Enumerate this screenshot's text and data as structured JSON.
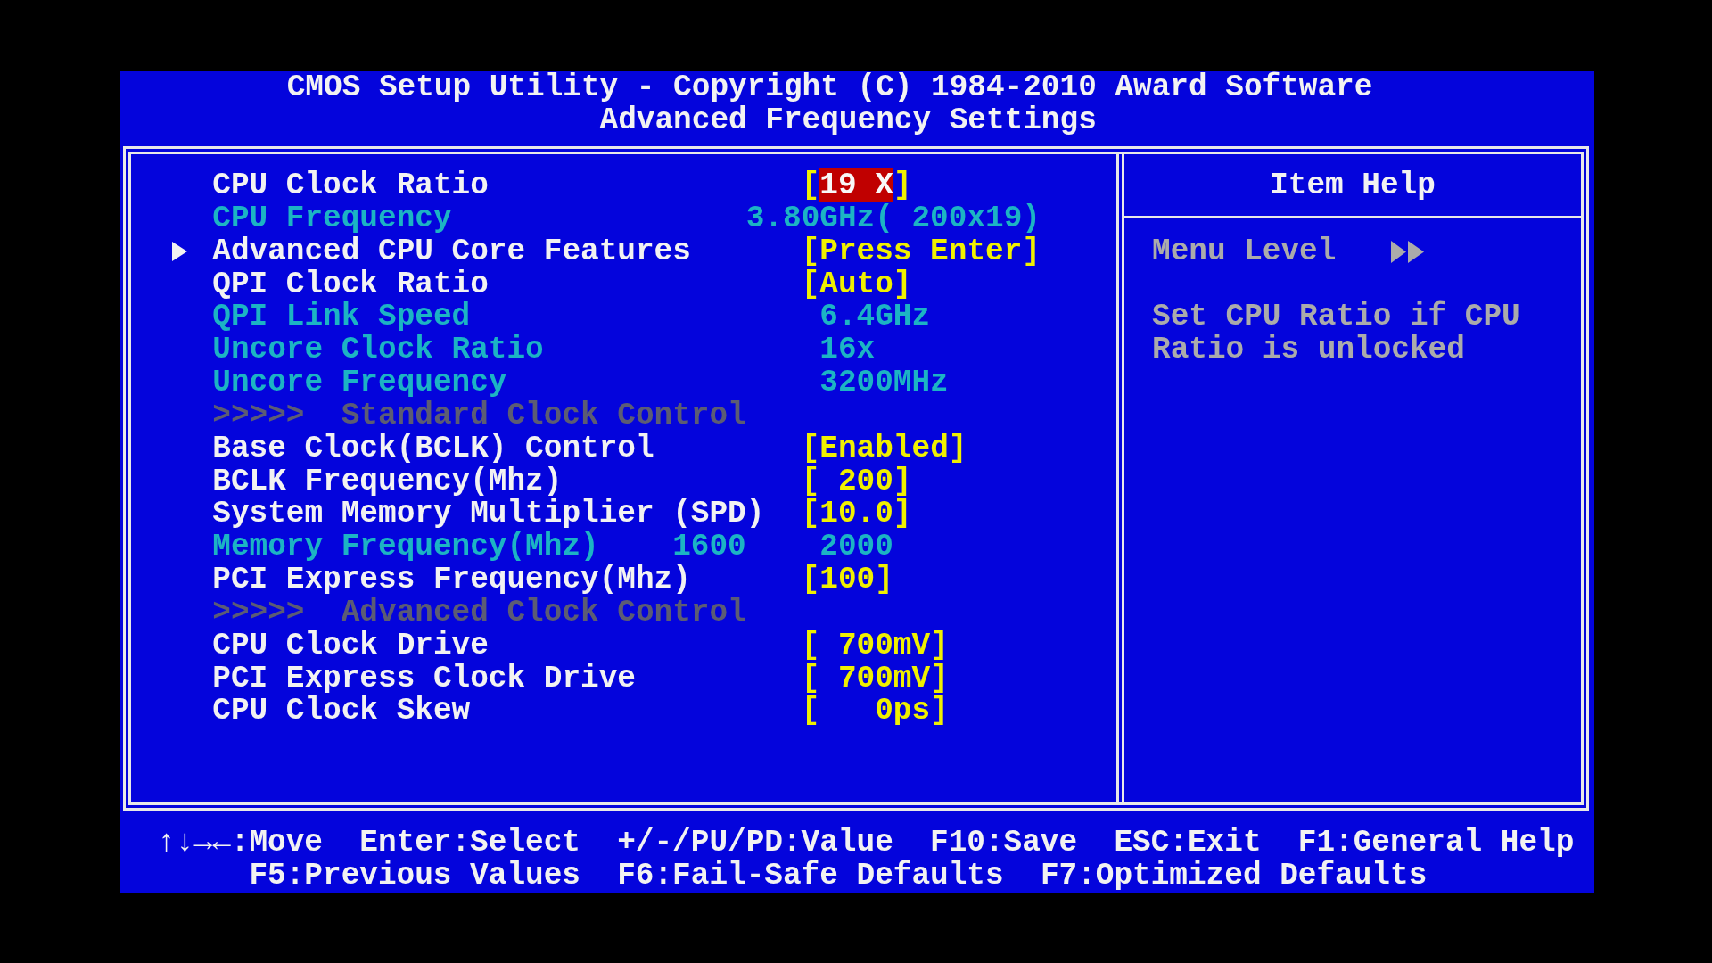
{
  "header": {
    "title": "CMOS Setup Utility - Copyright (C) 1984-2010 Award Software",
    "subtitle": "Advanced Frequency Settings"
  },
  "rows": [
    {
      "kind": "setting",
      "label": "CPU Clock Ratio",
      "value": "[19 X]",
      "selected": true
    },
    {
      "kind": "info",
      "label": "CPU Frequency",
      "value": "3.80GHz( 200x19)",
      "selected": false
    },
    {
      "kind": "submenu",
      "label": "Advanced CPU Core Features",
      "value": "[Press Enter]",
      "selected": false
    },
    {
      "kind": "setting",
      "label": "QPI Clock Ratio",
      "value": "[Auto]",
      "selected": false
    },
    {
      "kind": "info",
      "label": "QPI Link Speed",
      "value": "6.4GHz",
      "selected": false
    },
    {
      "kind": "info",
      "label": "Uncore Clock Ratio",
      "value": "16x",
      "selected": false
    },
    {
      "kind": "info",
      "label": "Uncore Frequency",
      "value": "3200MHz",
      "selected": false
    },
    {
      "kind": "section",
      "marker": ">>>>>",
      "label": "Standard Clock Control",
      "selected": false
    },
    {
      "kind": "setting",
      "label": "Base Clock(BCLK) Control",
      "value": "[Enabled]",
      "selected": false
    },
    {
      "kind": "setting",
      "label": "BCLK Frequency(Mhz)",
      "value": "[ 200]",
      "selected": false
    },
    {
      "kind": "setting",
      "label": "System Memory Multiplier (SPD)",
      "value": "[10.0]",
      "selected": false
    },
    {
      "kind": "info",
      "label": "Memory Frequency(Mhz)",
      "column_2": "1600",
      "value": "2000",
      "selected": false
    },
    {
      "kind": "setting",
      "label": "PCI Express Frequency(Mhz)",
      "value": "[100]",
      "selected": false
    },
    {
      "kind": "section",
      "marker": ">>>>>",
      "label": "Advanced Clock Control",
      "selected": false
    },
    {
      "kind": "setting",
      "label": "CPU Clock Drive",
      "value": "[ 700mV]",
      "selected": false
    },
    {
      "kind": "setting",
      "label": "PCI Express Clock Drive",
      "value": "[ 700mV]",
      "selected": false
    },
    {
      "kind": "setting",
      "label": "CPU Clock Skew",
      "value": "[   0ps]",
      "selected": false
    }
  ],
  "help": {
    "title": "Item Help",
    "menu_level_label": "Menu Level",
    "text": "Set CPU Ratio if CPU Ratio is unlocked"
  },
  "footer": {
    "lines": [
      {
        "hints": [
          "↑↓→←:Move",
          "Enter:Select",
          "+/-/PU/PD:Value",
          "F10:Save",
          "ESC:Exit",
          "F1:General Help"
        ]
      },
      {
        "hints": [
          "F5:Previous Values",
          "F6:Fail-Safe Defaults",
          "F7:Optimized Defaults"
        ]
      }
    ]
  }
}
